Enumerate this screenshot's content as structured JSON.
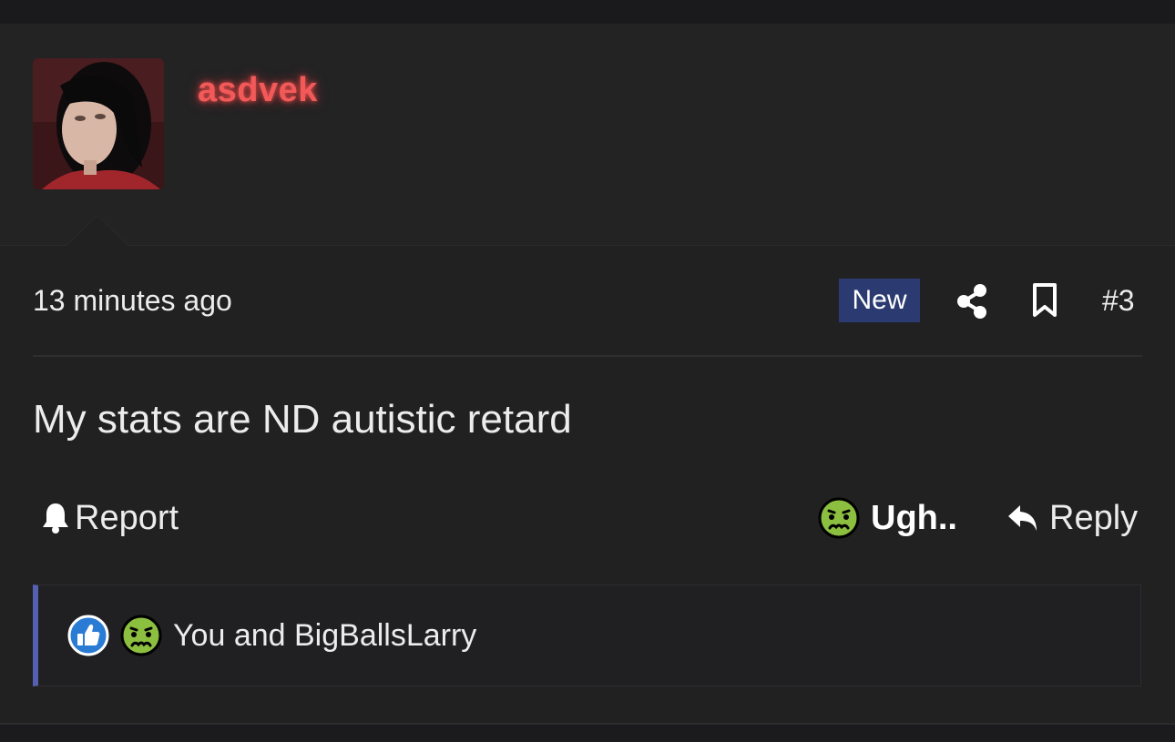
{
  "post": {
    "username": "asdvek",
    "username_color": "#f25a5a",
    "timestamp": "13 minutes ago",
    "badge": "New",
    "badge_color": "#2b3b72",
    "post_number": "#3",
    "body": "My stats are ND autistic retard",
    "icons": {
      "share": "share-icon",
      "bookmark": "bookmark-icon",
      "report": "bell-icon",
      "reply": "reply-arrow-icon",
      "reaction": "nauseated-face-icon",
      "like": "thumbs-up-icon"
    }
  },
  "actions": {
    "report_label": "Report",
    "reaction_label": "Ugh..",
    "reply_label": "Reply"
  },
  "reactions": {
    "summary": "You and BigBallsLarry",
    "accent_color": "#5560b0"
  }
}
